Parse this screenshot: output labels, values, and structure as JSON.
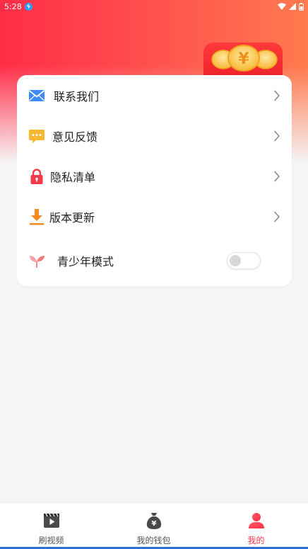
{
  "status_bar": {
    "time": "5:28"
  },
  "colors": {
    "accent": "#ff3347",
    "header_start": "#ff2d48",
    "header_end": "#ff7a4e",
    "background": "#f6f5f6"
  },
  "menu": {
    "items": [
      {
        "label": "联系我们",
        "icon": "mail-icon"
      },
      {
        "label": "意见反馈",
        "icon": "feedback-chat-icon"
      },
      {
        "label": "隐私清单",
        "icon": "lock-icon"
      },
      {
        "label": "版本更新",
        "icon": "download-icon"
      }
    ],
    "youth_mode": {
      "label": "青少年模式",
      "icon": "sprout-icon",
      "enabled": false
    }
  },
  "tabbar": {
    "tabs": [
      {
        "label": "刷视频",
        "icon": "video-icon",
        "active": false
      },
      {
        "label": "我的钱包",
        "icon": "money-bag-icon",
        "active": false
      },
      {
        "label": "我的",
        "icon": "user-icon",
        "active": true
      }
    ]
  }
}
